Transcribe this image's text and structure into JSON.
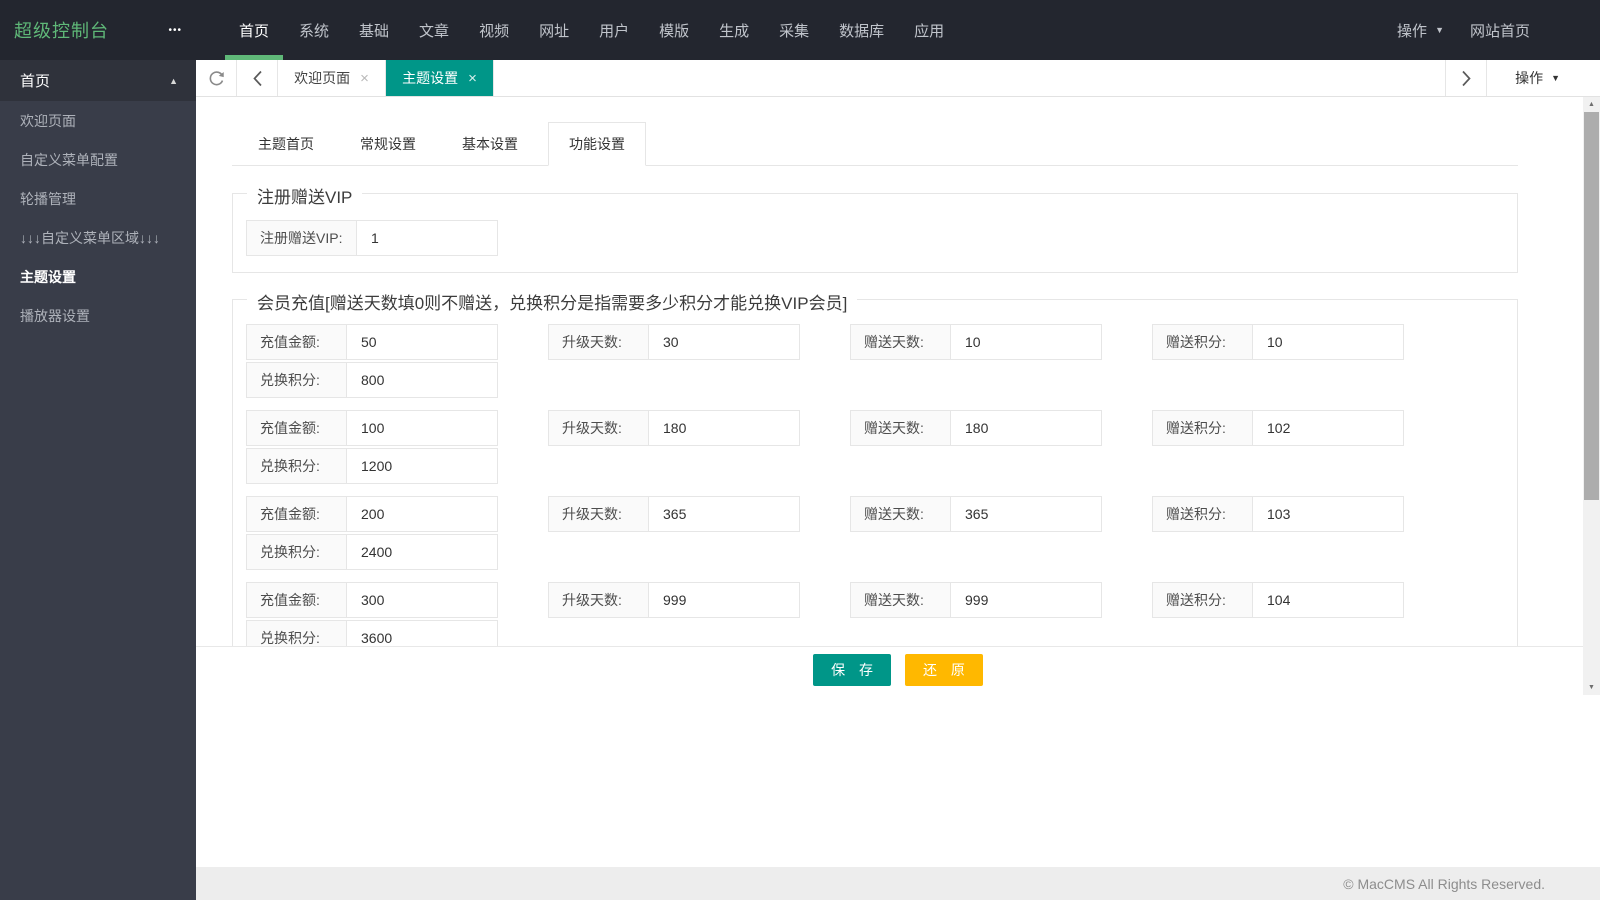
{
  "topbar": {
    "brand": "超级控制台",
    "nav": [
      {
        "label": "首页",
        "active": true
      },
      {
        "label": "系统"
      },
      {
        "label": "基础"
      },
      {
        "label": "文章"
      },
      {
        "label": "视频"
      },
      {
        "label": "网址"
      },
      {
        "label": "用户"
      },
      {
        "label": "模版"
      },
      {
        "label": "生成"
      },
      {
        "label": "采集"
      },
      {
        "label": "数据库"
      },
      {
        "label": "应用"
      }
    ],
    "action_label": "操作",
    "home_label": "网站首页"
  },
  "sidebar": {
    "section": "首页",
    "items": [
      {
        "label": "欢迎页面"
      },
      {
        "label": "自定义菜单配置"
      },
      {
        "label": "轮播管理"
      },
      {
        "label": "↓↓↓自定义菜单区域↓↓↓"
      },
      {
        "label": "主题设置",
        "active": true
      },
      {
        "label": "播放器设置"
      }
    ]
  },
  "tabbar": {
    "tabs": [
      {
        "label": "欢迎页面"
      },
      {
        "label": "主题设置",
        "active": true
      }
    ],
    "action_label": "操作"
  },
  "page": {
    "tabs": [
      "主题首页",
      "常规设置",
      "基本设置",
      "功能设置"
    ],
    "active_tab": "功能设置",
    "fieldset1": {
      "legend": "注册赠送VIP",
      "field": {
        "label": "注册赠送VIP:",
        "value": "1"
      }
    },
    "fieldset2": {
      "legend": "会员充值[赠送天数填0则不赠送，兑换积分是指需要多少积分才能兑换VIP会员]",
      "labels": {
        "amount": "充值金额:",
        "points": "兑换积分:",
        "days": "升级天数:",
        "gift_days": "赠送天数:",
        "gift_points": "赠送积分:"
      },
      "rows": [
        {
          "amount": "50",
          "points": "800",
          "days": "30",
          "gift_days": "10",
          "gift_points": "10"
        },
        {
          "amount": "100",
          "points": "1200",
          "days": "180",
          "gift_days": "180",
          "gift_points": "102"
        },
        {
          "amount": "200",
          "points": "2400",
          "days": "365",
          "gift_days": "365",
          "gift_points": "103"
        },
        {
          "amount": "300",
          "points": "3600",
          "days": "999",
          "gift_days": "999",
          "gift_points": "104"
        }
      ]
    },
    "buttons": {
      "save": "保 存",
      "restore": "还 原"
    }
  },
  "footer": {
    "copyright": "© MacCMS All Rights Reserved."
  },
  "icons": {
    "ellipsis": "•••",
    "caret_down": "▼",
    "caret_up": "▲",
    "close": "×",
    "scroll_up": "▲",
    "scroll_down": "▼"
  },
  "colors": {
    "accent_green": "#5FB878",
    "teal": "#009688",
    "yellow": "#FFB800",
    "topbar_bg": "#23262F",
    "sidebar_bg": "#393D49",
    "border": "#E6E6E6"
  }
}
